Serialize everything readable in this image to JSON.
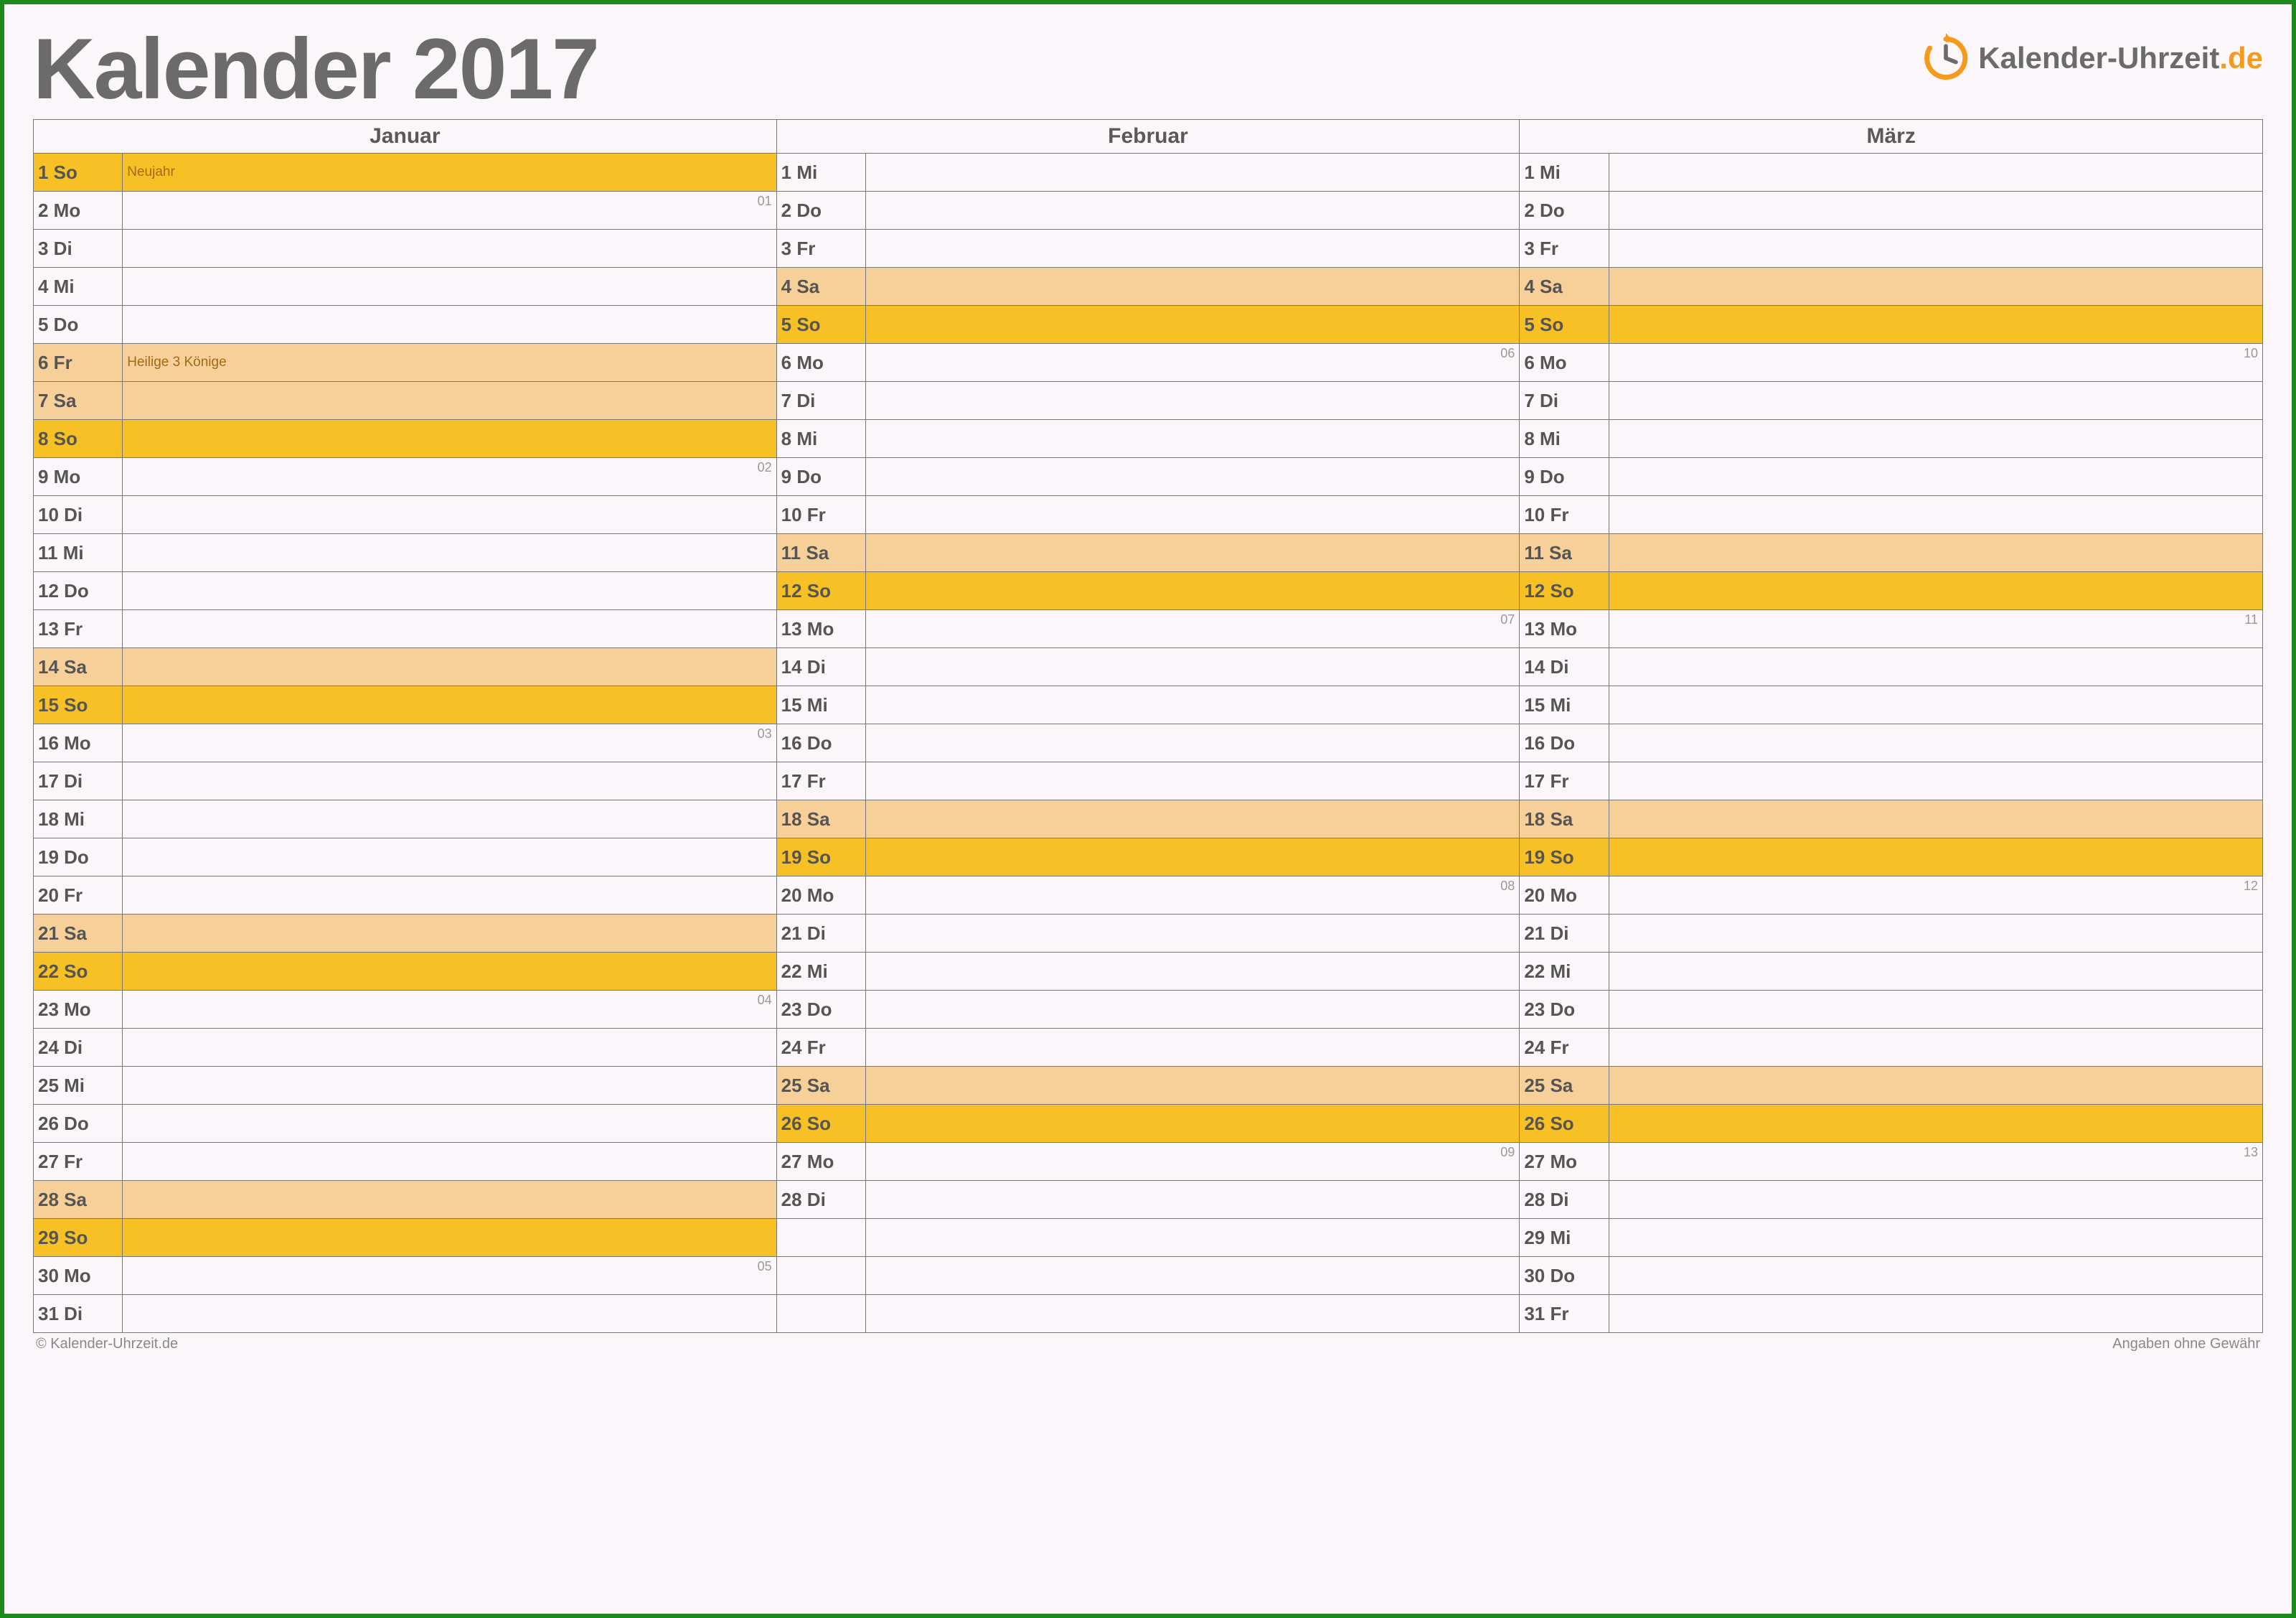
{
  "title": "Kalender 2017",
  "logo": {
    "name": "Kalender-Uhrzeit",
    "domain": ".de",
    "accent": "#f59a1a",
    "grey": "#6b6b6b"
  },
  "footer": {
    "left": "© Kalender-Uhrzeit.de",
    "right": "Angaben ohne Gewähr"
  },
  "months": [
    {
      "name": "Januar",
      "days": [
        {
          "n": "1",
          "d": "So",
          "type": "sun",
          "event": "Neujahr"
        },
        {
          "n": "2",
          "d": "Mo",
          "type": "reg",
          "wk": "01"
        },
        {
          "n": "3",
          "d": "Di",
          "type": "reg"
        },
        {
          "n": "4",
          "d": "Mi",
          "type": "reg"
        },
        {
          "n": "5",
          "d": "Do",
          "type": "reg"
        },
        {
          "n": "6",
          "d": "Fr",
          "type": "hol",
          "event": "Heilige 3 Könige"
        },
        {
          "n": "7",
          "d": "Sa",
          "type": "sat"
        },
        {
          "n": "8",
          "d": "So",
          "type": "sun"
        },
        {
          "n": "9",
          "d": "Mo",
          "type": "reg",
          "wk": "02"
        },
        {
          "n": "10",
          "d": "Di",
          "type": "reg"
        },
        {
          "n": "11",
          "d": "Mi",
          "type": "reg"
        },
        {
          "n": "12",
          "d": "Do",
          "type": "reg"
        },
        {
          "n": "13",
          "d": "Fr",
          "type": "reg"
        },
        {
          "n": "14",
          "d": "Sa",
          "type": "sat"
        },
        {
          "n": "15",
          "d": "So",
          "type": "sun"
        },
        {
          "n": "16",
          "d": "Mo",
          "type": "reg",
          "wk": "03"
        },
        {
          "n": "17",
          "d": "Di",
          "type": "reg"
        },
        {
          "n": "18",
          "d": "Mi",
          "type": "reg"
        },
        {
          "n": "19",
          "d": "Do",
          "type": "reg"
        },
        {
          "n": "20",
          "d": "Fr",
          "type": "reg"
        },
        {
          "n": "21",
          "d": "Sa",
          "type": "sat"
        },
        {
          "n": "22",
          "d": "So",
          "type": "sun"
        },
        {
          "n": "23",
          "d": "Mo",
          "type": "reg",
          "wk": "04"
        },
        {
          "n": "24",
          "d": "Di",
          "type": "reg"
        },
        {
          "n": "25",
          "d": "Mi",
          "type": "reg"
        },
        {
          "n": "26",
          "d": "Do",
          "type": "reg"
        },
        {
          "n": "27",
          "d": "Fr",
          "type": "reg"
        },
        {
          "n": "28",
          "d": "Sa",
          "type": "sat"
        },
        {
          "n": "29",
          "d": "So",
          "type": "sun"
        },
        {
          "n": "30",
          "d": "Mo",
          "type": "reg",
          "wk": "05"
        },
        {
          "n": "31",
          "d": "Di",
          "type": "reg"
        }
      ]
    },
    {
      "name": "Februar",
      "days": [
        {
          "n": "1",
          "d": "Mi",
          "type": "reg"
        },
        {
          "n": "2",
          "d": "Do",
          "type": "reg"
        },
        {
          "n": "3",
          "d": "Fr",
          "type": "reg"
        },
        {
          "n": "4",
          "d": "Sa",
          "type": "sat"
        },
        {
          "n": "5",
          "d": "So",
          "type": "sun"
        },
        {
          "n": "6",
          "d": "Mo",
          "type": "reg",
          "wk": "06"
        },
        {
          "n": "7",
          "d": "Di",
          "type": "reg"
        },
        {
          "n": "8",
          "d": "Mi",
          "type": "reg"
        },
        {
          "n": "9",
          "d": "Do",
          "type": "reg"
        },
        {
          "n": "10",
          "d": "Fr",
          "type": "reg"
        },
        {
          "n": "11",
          "d": "Sa",
          "type": "sat"
        },
        {
          "n": "12",
          "d": "So",
          "type": "sun"
        },
        {
          "n": "13",
          "d": "Mo",
          "type": "reg",
          "wk": "07"
        },
        {
          "n": "14",
          "d": "Di",
          "type": "reg"
        },
        {
          "n": "15",
          "d": "Mi",
          "type": "reg"
        },
        {
          "n": "16",
          "d": "Do",
          "type": "reg"
        },
        {
          "n": "17",
          "d": "Fr",
          "type": "reg"
        },
        {
          "n": "18",
          "d": "Sa",
          "type": "sat"
        },
        {
          "n": "19",
          "d": "So",
          "type": "sun"
        },
        {
          "n": "20",
          "d": "Mo",
          "type": "reg",
          "wk": "08"
        },
        {
          "n": "21",
          "d": "Di",
          "type": "reg"
        },
        {
          "n": "22",
          "d": "Mi",
          "type": "reg"
        },
        {
          "n": "23",
          "d": "Do",
          "type": "reg"
        },
        {
          "n": "24",
          "d": "Fr",
          "type": "reg"
        },
        {
          "n": "25",
          "d": "Sa",
          "type": "sat"
        },
        {
          "n": "26",
          "d": "So",
          "type": "sun"
        },
        {
          "n": "27",
          "d": "Mo",
          "type": "reg",
          "wk": "09"
        },
        {
          "n": "28",
          "d": "Di",
          "type": "reg"
        },
        {
          "n": "",
          "d": "",
          "type": "reg"
        },
        {
          "n": "",
          "d": "",
          "type": "reg"
        },
        {
          "n": "",
          "d": "",
          "type": "reg"
        }
      ]
    },
    {
      "name": "März",
      "days": [
        {
          "n": "1",
          "d": "Mi",
          "type": "reg"
        },
        {
          "n": "2",
          "d": "Do",
          "type": "reg"
        },
        {
          "n": "3",
          "d": "Fr",
          "type": "reg"
        },
        {
          "n": "4",
          "d": "Sa",
          "type": "sat"
        },
        {
          "n": "5",
          "d": "So",
          "type": "sun"
        },
        {
          "n": "6",
          "d": "Mo",
          "type": "reg",
          "wk": "10"
        },
        {
          "n": "7",
          "d": "Di",
          "type": "reg"
        },
        {
          "n": "8",
          "d": "Mi",
          "type": "reg"
        },
        {
          "n": "9",
          "d": "Do",
          "type": "reg"
        },
        {
          "n": "10",
          "d": "Fr",
          "type": "reg"
        },
        {
          "n": "11",
          "d": "Sa",
          "type": "sat"
        },
        {
          "n": "12",
          "d": "So",
          "type": "sun"
        },
        {
          "n": "13",
          "d": "Mo",
          "type": "reg",
          "wk": "11"
        },
        {
          "n": "14",
          "d": "Di",
          "type": "reg"
        },
        {
          "n": "15",
          "d": "Mi",
          "type": "reg"
        },
        {
          "n": "16",
          "d": "Do",
          "type": "reg"
        },
        {
          "n": "17",
          "d": "Fr",
          "type": "reg"
        },
        {
          "n": "18",
          "d": "Sa",
          "type": "sat"
        },
        {
          "n": "19",
          "d": "So",
          "type": "sun"
        },
        {
          "n": "20",
          "d": "Mo",
          "type": "reg",
          "wk": "12"
        },
        {
          "n": "21",
          "d": "Di",
          "type": "reg"
        },
        {
          "n": "22",
          "d": "Mi",
          "type": "reg"
        },
        {
          "n": "23",
          "d": "Do",
          "type": "reg"
        },
        {
          "n": "24",
          "d": "Fr",
          "type": "reg"
        },
        {
          "n": "25",
          "d": "Sa",
          "type": "sat"
        },
        {
          "n": "26",
          "d": "So",
          "type": "sun"
        },
        {
          "n": "27",
          "d": "Mo",
          "type": "reg",
          "wk": "13"
        },
        {
          "n": "28",
          "d": "Di",
          "type": "reg"
        },
        {
          "n": "29",
          "d": "Mi",
          "type": "reg"
        },
        {
          "n": "30",
          "d": "Do",
          "type": "reg"
        },
        {
          "n": "31",
          "d": "Fr",
          "type": "reg"
        }
      ]
    }
  ]
}
